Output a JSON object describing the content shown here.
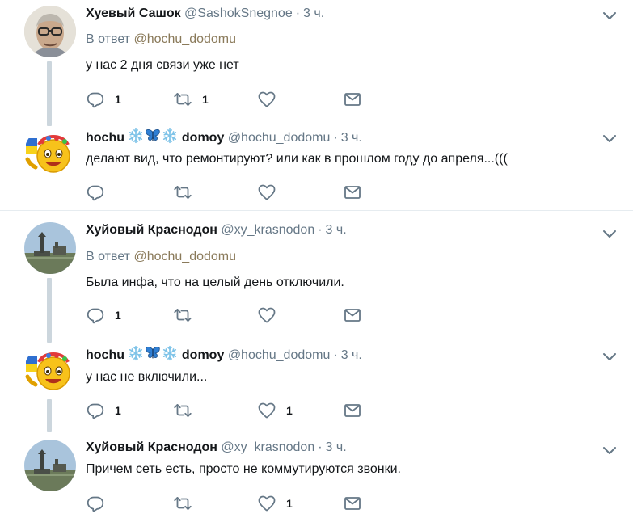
{
  "tweets": [
    {
      "name": "Хуевый Сашок",
      "handle": "@SashokSnegnoe",
      "time": "3 ч.",
      "reply_prefix": "В ответ",
      "reply_handle": "@hochu_dodomu",
      "text": "у нас 2 дня связи уже нет",
      "reply_count": "1",
      "retweet_count": "1",
      "like_count": ""
    },
    {
      "name_part1": "hochu",
      "name_part2": "domoy",
      "handle": "@hochu_dodomu",
      "time": "3 ч.",
      "text": "делают вид, что ремонтируют? или как в прошлом году до апреля...(((",
      "reply_count": "",
      "retweet_count": "",
      "like_count": ""
    },
    {
      "name": "Хуйовый Краснодон",
      "handle": "@xy_krasnodon",
      "time": "3 ч.",
      "reply_prefix": "В ответ",
      "reply_handle": "@hochu_dodomu",
      "text": "Была инфа, что на целый день отключили.",
      "reply_count": "1",
      "retweet_count": "",
      "like_count": ""
    },
    {
      "name_part1": "hochu",
      "name_part2": "domoy",
      "handle": "@hochu_dodomu",
      "time": "3 ч.",
      "text": "у нас не включили...",
      "reply_count": "1",
      "retweet_count": "",
      "like_count": "1"
    },
    {
      "name": "Хуйовый Краснодон",
      "handle": "@xy_krasnodon",
      "time": "3 ч.",
      "text": "Причем сеть есть, просто не коммутируются звонки.",
      "reply_count": "",
      "retweet_count": "",
      "like_count": "1"
    }
  ],
  "icons": {
    "reply": "reply-icon",
    "retweet": "retweet-icon",
    "like": "heart-icon",
    "dm": "envelope-icon",
    "menu": "chevron-down-icon",
    "name_decor": [
      "snowflake-icon",
      "butterfly-icon",
      "snowflake-icon"
    ]
  },
  "colors": {
    "icon": "#657786",
    "thread_line": "#ccd6dd",
    "separator": "#e6ecf0",
    "mention": "#8a7a5a"
  }
}
